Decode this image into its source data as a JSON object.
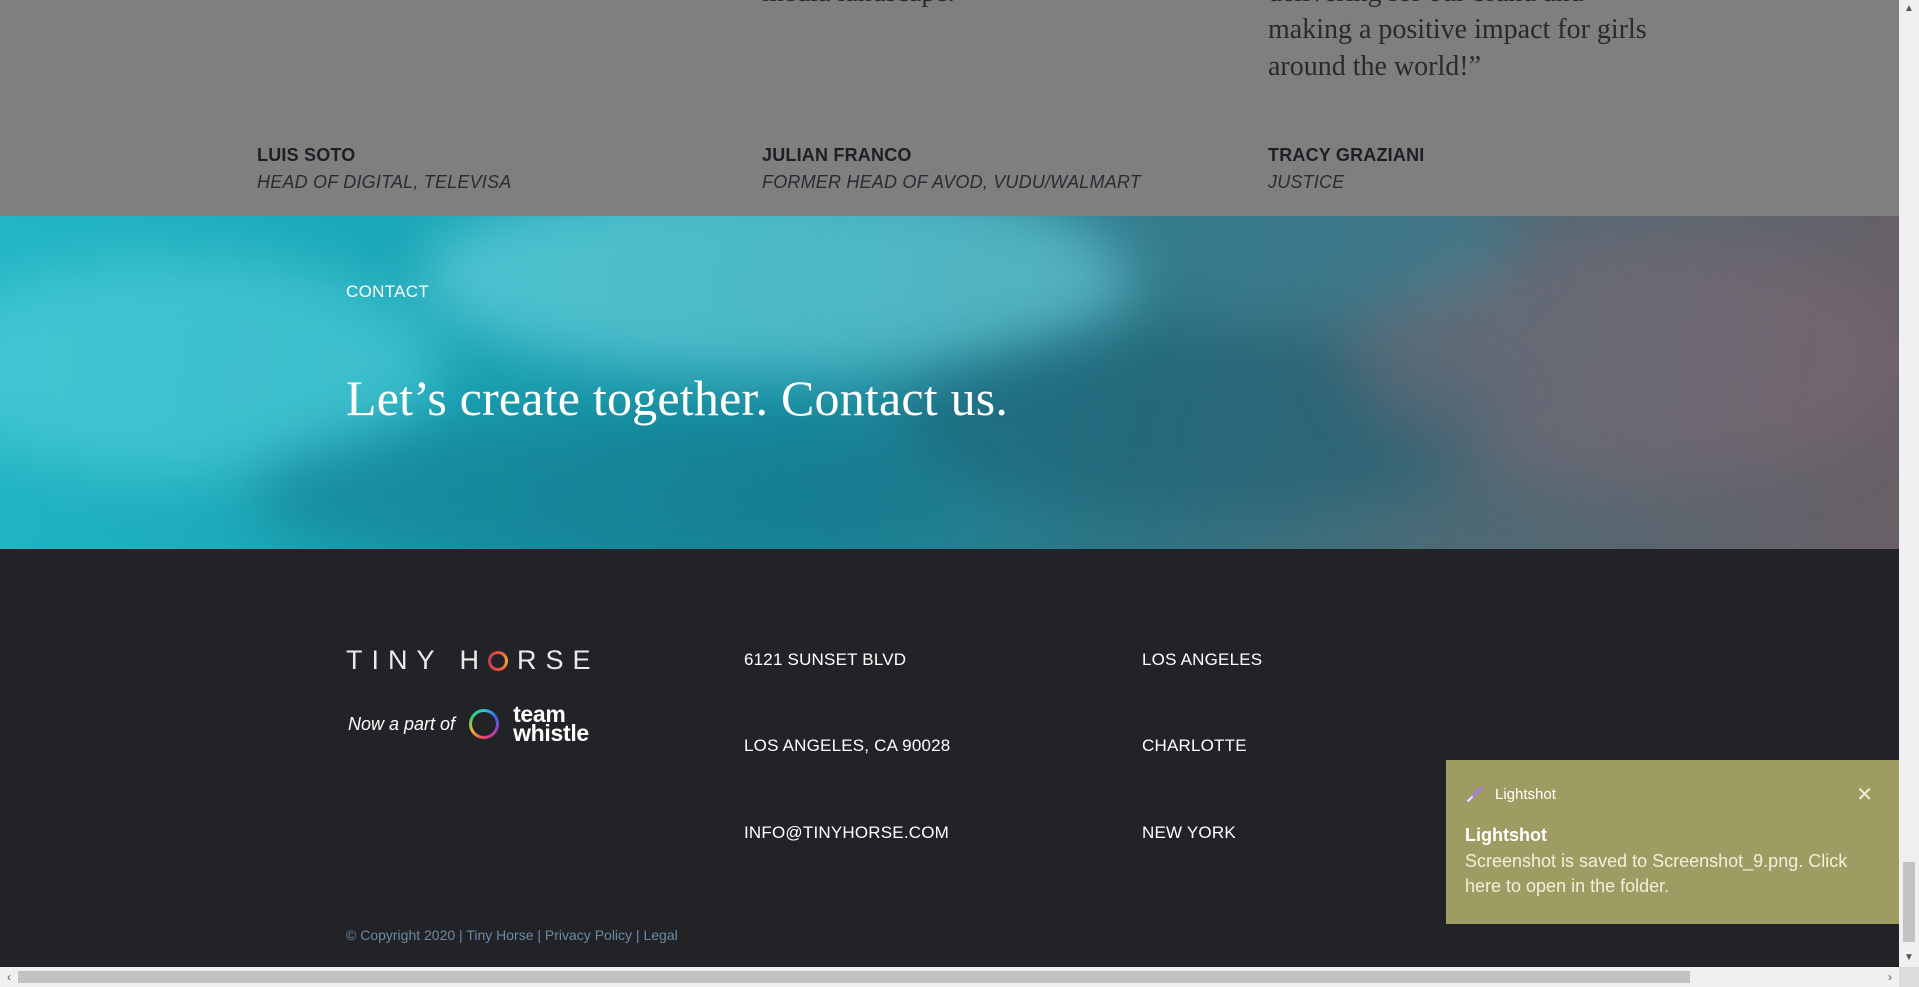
{
  "testimonials": {
    "quotes": [
      "media landscape.”",
      "delivering for our brand and making a positive impact for girls around the world!”"
    ],
    "people": [
      {
        "name": "LUIS SOTO",
        "role": "HEAD OF DIGITAL, TELEVISA"
      },
      {
        "name": "JULIAN FRANCO",
        "role": "FORMER HEAD OF AVOD, VUDU/WALMART"
      },
      {
        "name": "TRACY GRAZIANI",
        "role": "JUSTICE"
      }
    ]
  },
  "contact": {
    "eyebrow": "CONTACT",
    "headline": "Let’s create together. Contact us."
  },
  "footer": {
    "logo_left": "TINY H",
    "logo_right": "RSE",
    "now_part_of": "Now a part of",
    "partner_line1": "team",
    "partner_line2": "whistle",
    "address": [
      "6121 SUNSET BLVD",
      "LOS ANGELES, CA 90028",
      "INFO@TINYHORSE.COM"
    ],
    "cities": [
      "LOS ANGELES",
      "CHARLOTTE",
      "NEW YORK"
    ],
    "copyright": "© Copyright 2020 | Tiny Horse | ",
    "privacy": "Privacy Policy",
    "sep": " | ",
    "legal": "Legal"
  },
  "toast": {
    "app_name": "Lightshot",
    "title": "Lightshot",
    "message": "Screenshot is saved to Screenshot_9.png. Click here to open in the folder.",
    "close_glyph": "✕",
    "icon": "pen-icon"
  },
  "colors": {
    "footer_bg": "#222327",
    "toast_bg": "#9f9c63",
    "hero_teal": "#22b6c5"
  }
}
